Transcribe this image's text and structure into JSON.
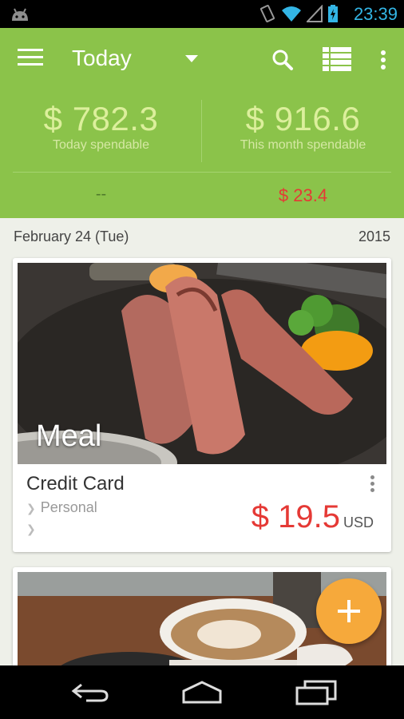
{
  "status_bar": {
    "time": "23:39",
    "icons": [
      "android-icon",
      "vibrate-icon",
      "wifi-icon",
      "signal-icon",
      "battery-charging-icon"
    ]
  },
  "toolbar": {
    "title": "Today",
    "icons": [
      "menu-icon",
      "search-icon",
      "list-view-icon",
      "overflow-icon"
    ]
  },
  "summary": {
    "today_value": "$ 782.3",
    "today_label": "Today spendable",
    "month_value": "$ 916.6",
    "month_label": "This month spendable",
    "left_bottom": "--",
    "right_bottom": "$ 23.4"
  },
  "date_header": {
    "date": "February 24 (Tue)",
    "year": "2015"
  },
  "entries": [
    {
      "category": "Meal",
      "account": "Credit Card",
      "tag1": "Personal",
      "tag2": "",
      "amount": "$ 19.5",
      "currency": "USD"
    }
  ],
  "colors": {
    "header_green": "#8bc34a",
    "amount_red": "#e53935",
    "fab_orange": "#f6a93b",
    "status_blue": "#33b5e5"
  },
  "fab": {
    "icon": "plus-icon"
  },
  "nav": {
    "icons": [
      "back-icon",
      "home-icon",
      "recents-icon"
    ]
  }
}
